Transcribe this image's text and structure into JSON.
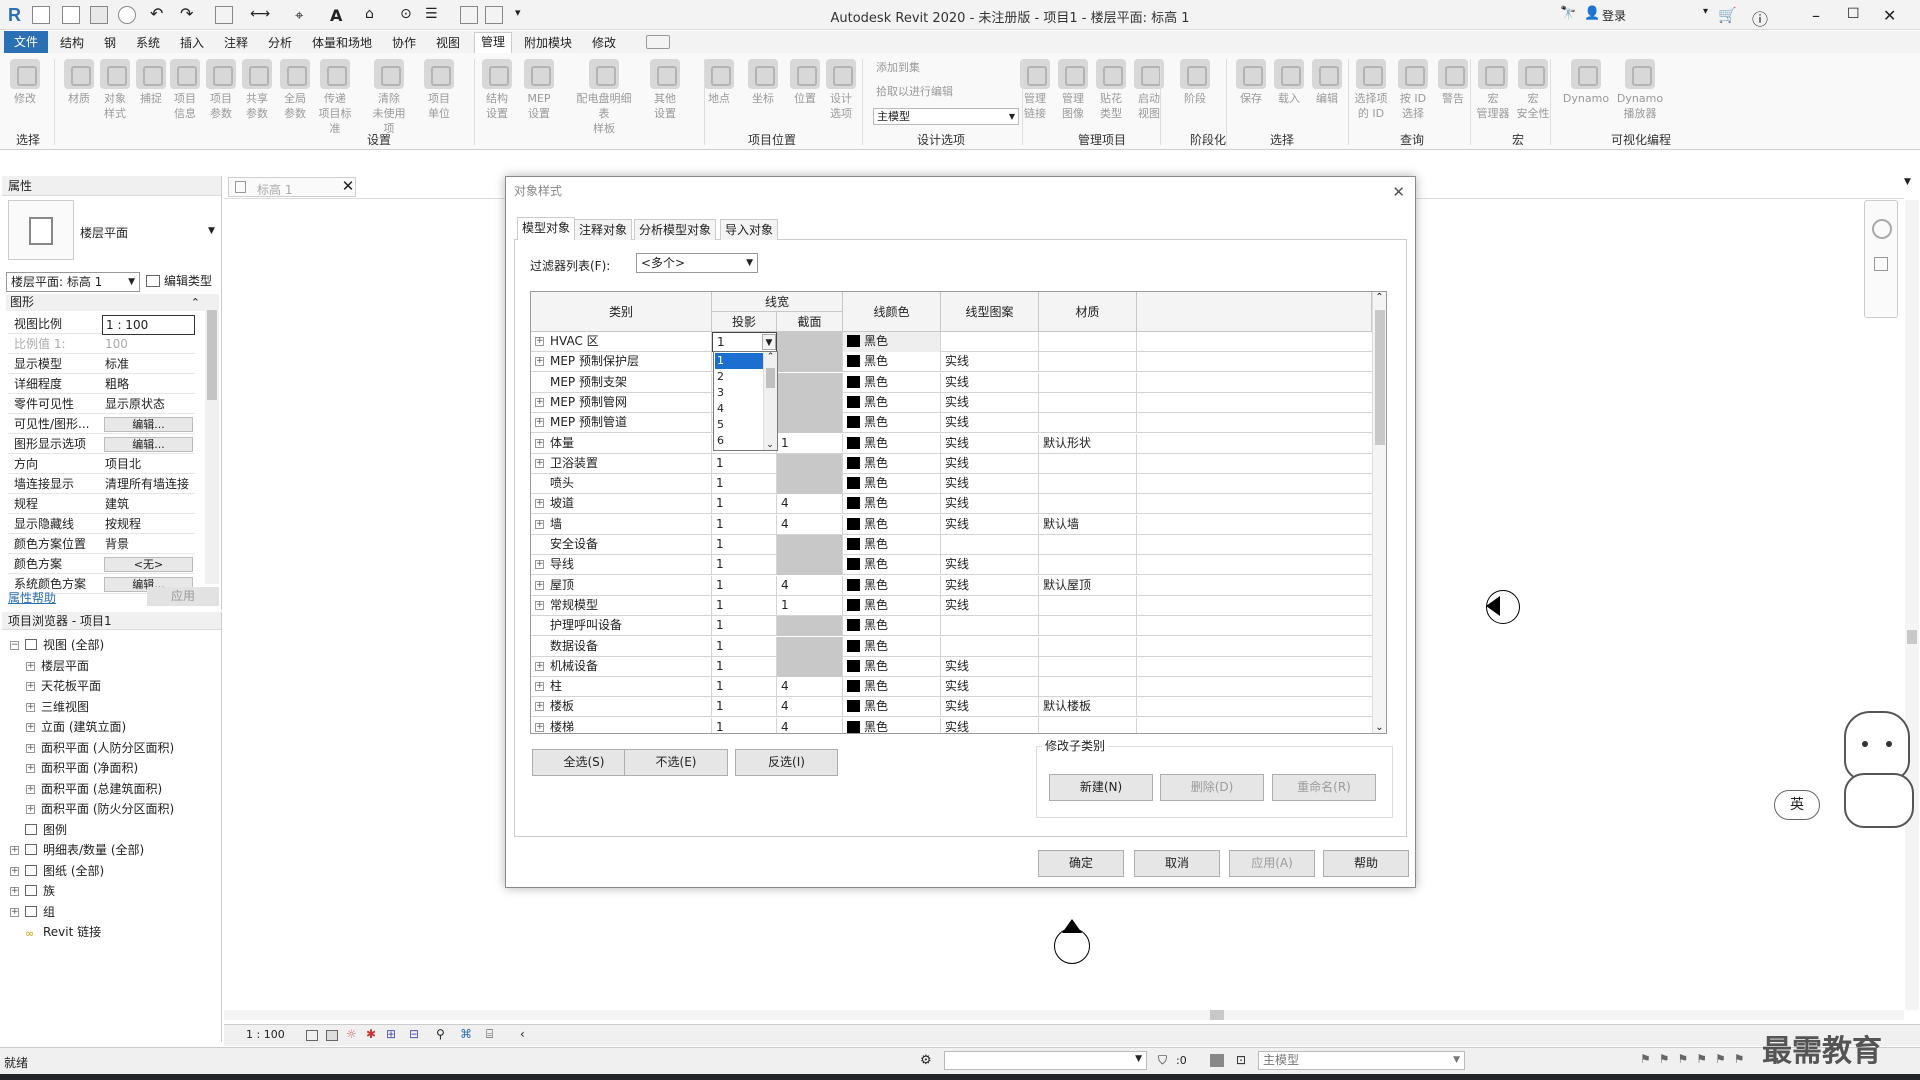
{
  "title": "Autodesk Revit 2020 - 未注册版 - 项目1 - 楼层平面: 标高 1",
  "titlebar": {
    "login": "登录"
  },
  "menu": [
    "文件",
    "结构",
    "钢",
    "系统",
    "插入",
    "注释",
    "分析",
    "体量和场地",
    "协作",
    "视图",
    "管理",
    "附加模块",
    "修改"
  ],
  "ribbon": {
    "buttons": [
      [
        "修改",
        ""
      ],
      [
        "材质",
        ""
      ],
      [
        "对象",
        "样式"
      ],
      [
        "捕捉",
        ""
      ],
      [
        "项目",
        "信息"
      ],
      [
        "项目",
        "参数"
      ],
      [
        "共享",
        "参数"
      ],
      [
        "全局",
        "参数"
      ],
      [
        "传递",
        "项目标准"
      ],
      [
        "清除",
        "未使用项"
      ],
      [
        "项目",
        "单位"
      ],
      [
        "结构",
        "设置"
      ],
      [
        "MEP",
        "设置"
      ],
      [
        "配电盘明细表",
        "样板"
      ],
      [
        "其他",
        "设置"
      ],
      [
        "地点",
        ""
      ],
      [
        "坐标",
        ""
      ],
      [
        "位置",
        ""
      ],
      [
        "设计",
        "选项"
      ],
      [
        "管理",
        "链接"
      ],
      [
        "管理",
        "图像"
      ],
      [
        "贴花",
        "类型"
      ],
      [
        "启动",
        "视图"
      ],
      [
        "阶段",
        ""
      ],
      [
        "保存",
        ""
      ],
      [
        "载入",
        ""
      ],
      [
        "编辑",
        ""
      ],
      [
        "选择项",
        "的 ID"
      ],
      [
        "按 ID",
        "选择"
      ],
      [
        "警告",
        ""
      ],
      [
        "宏",
        "管理器"
      ],
      [
        "宏",
        "安全性"
      ],
      [
        "Dynamo",
        ""
      ],
      [
        "Dynamo",
        "播放器"
      ]
    ],
    "small": [
      "添加到集",
      "拾取以进行编辑"
    ],
    "design_option": "主模型",
    "groups": [
      "选择",
      "设置",
      "项目位置",
      "设计选项",
      "管理项目",
      "阶段化",
      "选择",
      "查询",
      "宏",
      "可视化编程"
    ]
  },
  "properties": {
    "title": "属性",
    "type_name": "楼层平面",
    "instance": "楼层平面: 标高 1",
    "edit_type": "编辑类型",
    "section": "图形",
    "rows": [
      {
        "k": "视图比例",
        "v": "1 : 100"
      },
      {
        "k": "比例值 1:",
        "v": "100"
      },
      {
        "k": "显示模型",
        "v": "标准"
      },
      {
        "k": "详细程度",
        "v": "粗略"
      },
      {
        "k": "零件可见性",
        "v": "显示原状态"
      },
      {
        "k": "可见性/图形...",
        "v": "编辑..."
      },
      {
        "k": "图形显示选项",
        "v": "编辑..."
      },
      {
        "k": "方向",
        "v": "项目北"
      },
      {
        "k": "墙连接显示",
        "v": "清理所有墙连接"
      },
      {
        "k": "规程",
        "v": "建筑"
      },
      {
        "k": "显示隐藏线",
        "v": "按规程"
      },
      {
        "k": "颜色方案位置",
        "v": "背景"
      },
      {
        "k": "颜色方案",
        "v": "<无>"
      },
      {
        "k": "系统颜色方案",
        "v": "编辑..."
      }
    ],
    "help": "属性帮助",
    "apply": "应用"
  },
  "browser": {
    "title": "项目浏览器 - 项目1",
    "items": [
      "视图 (全部)",
      "楼层平面",
      "天花板平面",
      "三维视图",
      "立面 (建筑立面)",
      "面积平面 (人防分区面积)",
      "面积平面 (净面积)",
      "面积平面 (总建筑面积)",
      "面积平面 (防火分区面积)",
      "图例",
      "明细表/数量 (全部)",
      "图纸 (全部)",
      "族",
      "组",
      "Revit 链接"
    ]
  },
  "view_tab": "标高 1",
  "dialog": {
    "title": "对象样式",
    "tabs": [
      "模型对象",
      "注释对象",
      "分析模型对象",
      "导入对象"
    ],
    "filter_label": "过滤器列表(F):",
    "filter_value": "<多个>",
    "headers": {
      "category": "类别",
      "lineweight": "线宽",
      "projection": "投影",
      "cut": "截面",
      "color": "线颜色",
      "pattern": "线型图案",
      "material": "材质"
    },
    "rows": [
      {
        "name": "HVAC 区",
        "proj": "1",
        "cut": "",
        "color": "黑色",
        "pattern": "",
        "mat": "",
        "exp": true
      },
      {
        "name": "MEP 预制保护层",
        "proj": "1",
        "cut": "",
        "color": "黑色",
        "pattern": "实线",
        "mat": "",
        "exp": true
      },
      {
        "name": "MEP 预制支架",
        "proj": "1",
        "cut": "",
        "color": "黑色",
        "pattern": "实线",
        "mat": "",
        "exp": false
      },
      {
        "name": "MEP 预制管网",
        "proj": "1",
        "cut": "",
        "color": "黑色",
        "pattern": "实线",
        "mat": "",
        "exp": true
      },
      {
        "name": "MEP 预制管道",
        "proj": "1",
        "cut": "",
        "color": "黑色",
        "pattern": "实线",
        "mat": "",
        "exp": true
      },
      {
        "name": "体量",
        "proj": "1",
        "cut": "1",
        "color": "黑色",
        "pattern": "实线",
        "mat": "默认形状",
        "exp": true
      },
      {
        "name": "卫浴装置",
        "proj": "1",
        "cut": "",
        "color": "黑色",
        "pattern": "实线",
        "mat": "",
        "exp": true
      },
      {
        "name": "喷头",
        "proj": "1",
        "cut": "",
        "color": "黑色",
        "pattern": "实线",
        "mat": "",
        "exp": false
      },
      {
        "name": "坡道",
        "proj": "1",
        "cut": "4",
        "color": "黑色",
        "pattern": "实线",
        "mat": "",
        "exp": true
      },
      {
        "name": "墙",
        "proj": "1",
        "cut": "4",
        "color": "黑色",
        "pattern": "实线",
        "mat": "默认墙",
        "exp": true
      },
      {
        "name": "安全设备",
        "proj": "1",
        "cut": "",
        "color": "黑色",
        "pattern": "",
        "mat": "",
        "exp": false
      },
      {
        "name": "导线",
        "proj": "1",
        "cut": "",
        "color": "黑色",
        "pattern": "实线",
        "mat": "",
        "exp": true
      },
      {
        "name": "屋顶",
        "proj": "1",
        "cut": "4",
        "color": "黑色",
        "pattern": "实线",
        "mat": "默认屋顶",
        "exp": true
      },
      {
        "name": "常规模型",
        "proj": "1",
        "cut": "1",
        "color": "黑色",
        "pattern": "实线",
        "mat": "",
        "exp": true
      },
      {
        "name": "护理呼叫设备",
        "proj": "1",
        "cut": "",
        "color": "黑色",
        "pattern": "",
        "mat": "",
        "exp": false
      },
      {
        "name": "数据设备",
        "proj": "1",
        "cut": "",
        "color": "黑色",
        "pattern": "",
        "mat": "",
        "exp": false
      },
      {
        "name": "机械设备",
        "proj": "1",
        "cut": "",
        "color": "黑色",
        "pattern": "实线",
        "mat": "",
        "exp": true
      },
      {
        "name": "柱",
        "proj": "1",
        "cut": "4",
        "color": "黑色",
        "pattern": "实线",
        "mat": "",
        "exp": true
      },
      {
        "name": "楼板",
        "proj": "1",
        "cut": "4",
        "color": "黑色",
        "pattern": "实线",
        "mat": "默认楼板",
        "exp": true
      },
      {
        "name": "楼梯",
        "proj": "1",
        "cut": "4",
        "color": "黑色",
        "pattern": "实线",
        "mat": "",
        "exp": true
      }
    ],
    "dropdown_options": [
      "1",
      "2",
      "3",
      "4",
      "5",
      "6"
    ],
    "select_all": "全选(S)",
    "select_none": "不选(E)",
    "invert": "反选(I)",
    "modify_sub": "修改子类别",
    "new": "新建(N)",
    "delete": "删除(D)",
    "rename": "重命名(R)",
    "ok": "确定",
    "cancel": "取消",
    "apply": "应用(A)",
    "help": "帮助"
  },
  "view_scale": "1 : 100",
  "status": {
    "ready": "就绪",
    "coord": ":0",
    "model": "主模型"
  },
  "ime": "英",
  "watermark": "最需教育",
  "accent": "#2b6fb5"
}
